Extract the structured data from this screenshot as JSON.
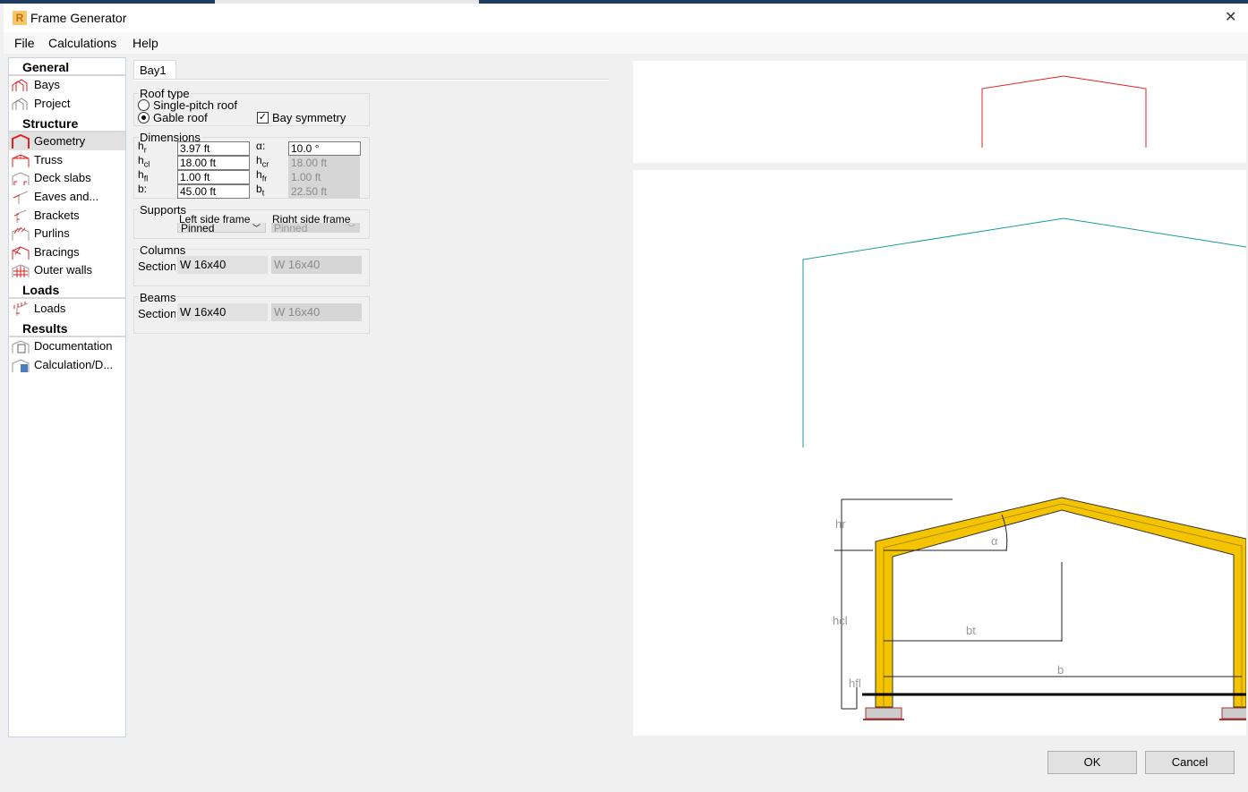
{
  "window": {
    "title": "Frame Generator",
    "behind_title": "Objects of a model"
  },
  "menu": [
    "File",
    "Calculations",
    "Help"
  ],
  "sidebar": {
    "sections": [
      {
        "title": "General",
        "items": [
          "Bays",
          "Project"
        ]
      },
      {
        "title": "Structure",
        "items": [
          "Geometry",
          "Truss",
          "Deck slabs",
          "Eaves and...",
          "Brackets",
          "Purlins",
          "Bracings",
          "Outer walls"
        ]
      },
      {
        "title": "Loads",
        "items": [
          "Loads"
        ]
      },
      {
        "title": "Results",
        "items": [
          "Documentation",
          "Calculation/D..."
        ]
      }
    ],
    "selected": "Geometry"
  },
  "tab": "Bay1",
  "roof_type": {
    "label": "Roof type",
    "options": [
      "Single-pitch roof",
      "Gable roof"
    ],
    "selected": "Gable roof",
    "bay_symmetry_label": "Bay symmetry",
    "bay_symmetry": true
  },
  "dimensions": {
    "label": "Dimensions",
    "left": [
      {
        "label": "h",
        "sub": "r",
        "value": "3.97 ft"
      },
      {
        "label": "h",
        "sub": "cl",
        "value": "18.00 ft"
      },
      {
        "label": "h",
        "sub": "fl",
        "value": "1.00 ft"
      },
      {
        "label": "b:",
        "sub": "",
        "value": "45.00 ft"
      }
    ],
    "right": [
      {
        "label": "α:",
        "sub": "",
        "value": "10.0 °"
      },
      {
        "label": "h",
        "sub": "cr",
        "value": "18.00 ft"
      },
      {
        "label": "h",
        "sub": "fr",
        "value": "1.00 ft"
      },
      {
        "label": "b",
        "sub": "t",
        "value": "22.50 ft"
      }
    ]
  },
  "supports": {
    "label": "Supports",
    "left_label": "Left side frame",
    "left_value": "Pinned",
    "right_label": "Right side frame",
    "right_value": "Pinned"
  },
  "columns": {
    "label": "Columns",
    "section_label": "Section",
    "value": "W 16x40",
    "value_right": "W 16x40"
  },
  "beams": {
    "label": "Beams",
    "section_label": "Section",
    "value": "W 16x40",
    "value_right": "W 16x40"
  },
  "diagram_labels": {
    "hr": "hr",
    "hcl": "hcl",
    "hfl": "hfl",
    "alpha": "α",
    "bt": "bt",
    "b": "b"
  },
  "buttons": {
    "ok": "OK",
    "cancel": "Cancel"
  }
}
